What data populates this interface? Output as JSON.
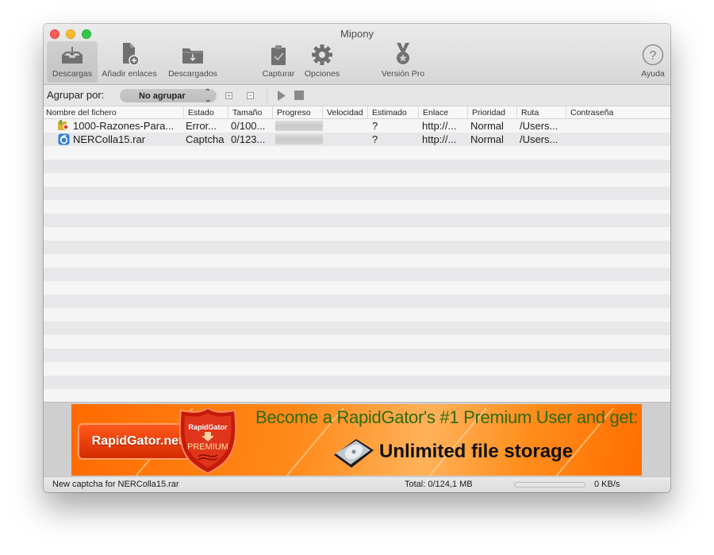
{
  "window": {
    "title": "Mipony"
  },
  "toolbar": {
    "buttons": [
      {
        "id": "descargas",
        "label": "Descargas",
        "icon": "inbox-download-icon",
        "active": true
      },
      {
        "id": "anadir",
        "label": "Añadir enlaces",
        "icon": "add-file-icon",
        "active": false
      },
      {
        "id": "descargados",
        "label": "Descargados",
        "icon": "folder-download-icon",
        "active": false
      },
      {
        "id": "capturar",
        "label": "Capturar",
        "icon": "clipboard-check-icon",
        "active": false
      },
      {
        "id": "opciones",
        "label": "Opciones",
        "icon": "gear-icon",
        "active": false
      },
      {
        "id": "version_pro",
        "label": "Versión Pro",
        "icon": "medal-icon",
        "active": false
      },
      {
        "id": "ayuda",
        "label": "Ayuda",
        "icon": "help-icon",
        "active": false
      }
    ]
  },
  "groupbar": {
    "label": "Agrupar por:",
    "select_value": "No agrupar",
    "expand_symbol": "+",
    "collapse_symbol": "−"
  },
  "table": {
    "columns": [
      "Nombre del fichero",
      "Estado",
      "Tamaño",
      "Progreso",
      "Velocidad",
      "Estimado",
      "Enlace",
      "Prioridad",
      "Ruta",
      "Contraseña"
    ],
    "rows": [
      {
        "name": "1000-Razones-Para...",
        "icon": "archive-error-icon",
        "status": "Error...",
        "size": "0/100...",
        "progress": 0,
        "speed": "",
        "estimated": "?",
        "link": "http://...",
        "priority": "Normal",
        "path": "/Users...",
        "password": ""
      },
      {
        "name": "NERColla15.rar",
        "icon": "captcha-icon",
        "status": "Captcha",
        "size": "0/123...",
        "progress": 0,
        "speed": "",
        "estimated": "?",
        "link": "http://...",
        "priority": "Normal",
        "path": "/Users...",
        "password": ""
      }
    ]
  },
  "ad": {
    "button_text": "RapidGator.net",
    "badge_top": "RapidGator",
    "badge_bottom": "PREMIUM",
    "headline": "Become a RapidGator's #1 Premium User and get:",
    "subline": "Unlimited file storage",
    "colors": {
      "orange": "#ff7a10",
      "headline": "#2d6b10"
    }
  },
  "statusbar": {
    "message": "New captcha for NERColla15.rar",
    "total": "Total: 0/124,1 MB",
    "progress": 0,
    "speed": "0 KB/s"
  }
}
